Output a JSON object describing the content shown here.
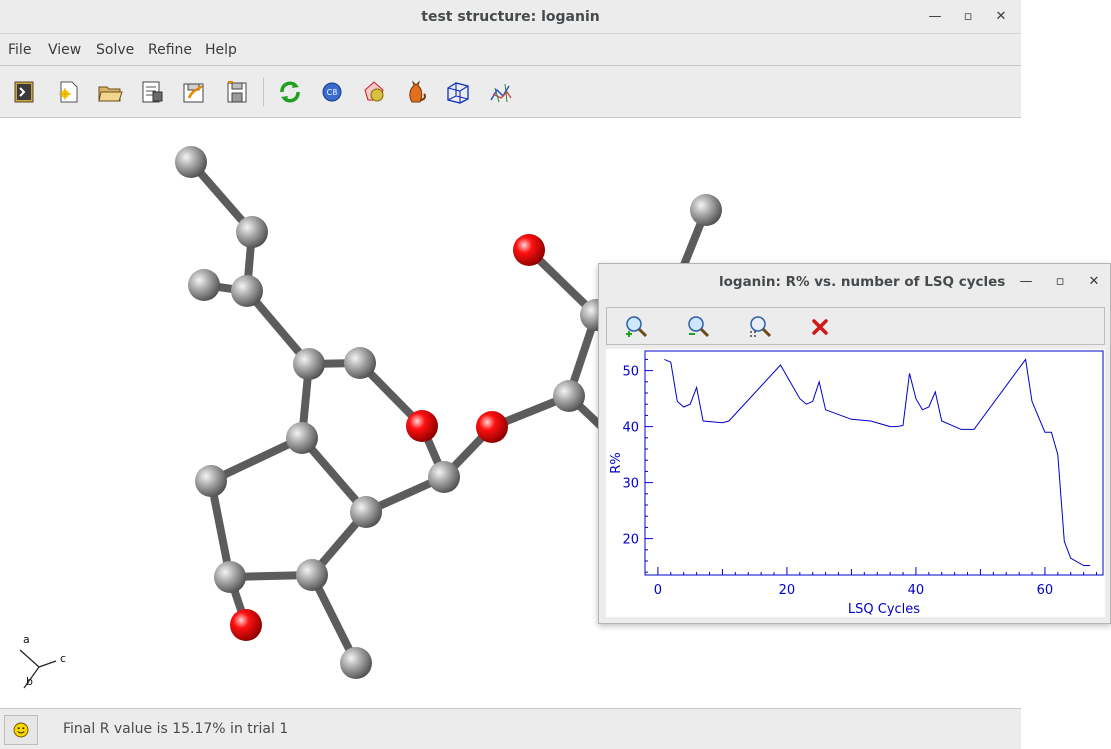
{
  "window": {
    "title": "test structure: loganin",
    "minimize_glyph": "—",
    "maximize_glyph": "▫",
    "close_glyph": "✕"
  },
  "menu": [
    "File",
    "View",
    "Solve",
    "Refine",
    "Help"
  ],
  "toolbar": {
    "icons": [
      "open-terminal-icon",
      "new-file-icon",
      "open-folder-icon",
      "properties-icon",
      "save-as-icon",
      "save-icon",
      "refresh-icon",
      "cb-icon",
      "grow-icon",
      "cat-icon",
      "cell-icon",
      "fragment-icon"
    ]
  },
  "axes_indicator": {
    "a": "a",
    "b": "b",
    "c": "c"
  },
  "status": {
    "icon": "smiley-icon",
    "text": "Final R value is 15.17% in trial 1"
  },
  "plot_window": {
    "title": "loganin: R% vs. number of LSQ cycles",
    "toolbar_icons": [
      "zoom-in-icon",
      "zoom-out-icon",
      "zoom-reset-icon",
      "close-red-icon"
    ],
    "colors": {
      "line": "#0000cc",
      "axis": "#0000cc"
    }
  },
  "chart_data": {
    "type": "line",
    "title": "",
    "xlabel": "LSQ Cycles",
    "ylabel": "R%",
    "xlim": [
      -2,
      69
    ],
    "ylim": [
      13.5,
      53.5
    ],
    "xticks": [
      0,
      20,
      40,
      60
    ],
    "yticks": [
      20,
      30,
      40,
      50
    ],
    "series": [
      {
        "x": [
          1,
          2,
          3,
          4,
          5,
          6,
          7,
          10,
          11,
          19,
          22,
          23,
          24,
          25,
          26,
          30,
          33,
          36,
          37,
          38,
          39,
          40,
          41,
          42,
          43,
          44,
          46,
          47,
          48,
          49,
          57,
          58,
          60,
          61,
          62,
          63,
          64,
          66,
          67
        ],
        "y": [
          52,
          51.5,
          44.5,
          43.5,
          44,
          47,
          41,
          40.7,
          41,
          51,
          45,
          44,
          44.5,
          48,
          43,
          41.3,
          41,
          40,
          40,
          40.2,
          49.5,
          45,
          43,
          43.5,
          46.2,
          41,
          40,
          39.5,
          39.5,
          39.5,
          52,
          44.5,
          39,
          39,
          35,
          19.5,
          16.5,
          15.2,
          15.2
        ]
      }
    ]
  }
}
